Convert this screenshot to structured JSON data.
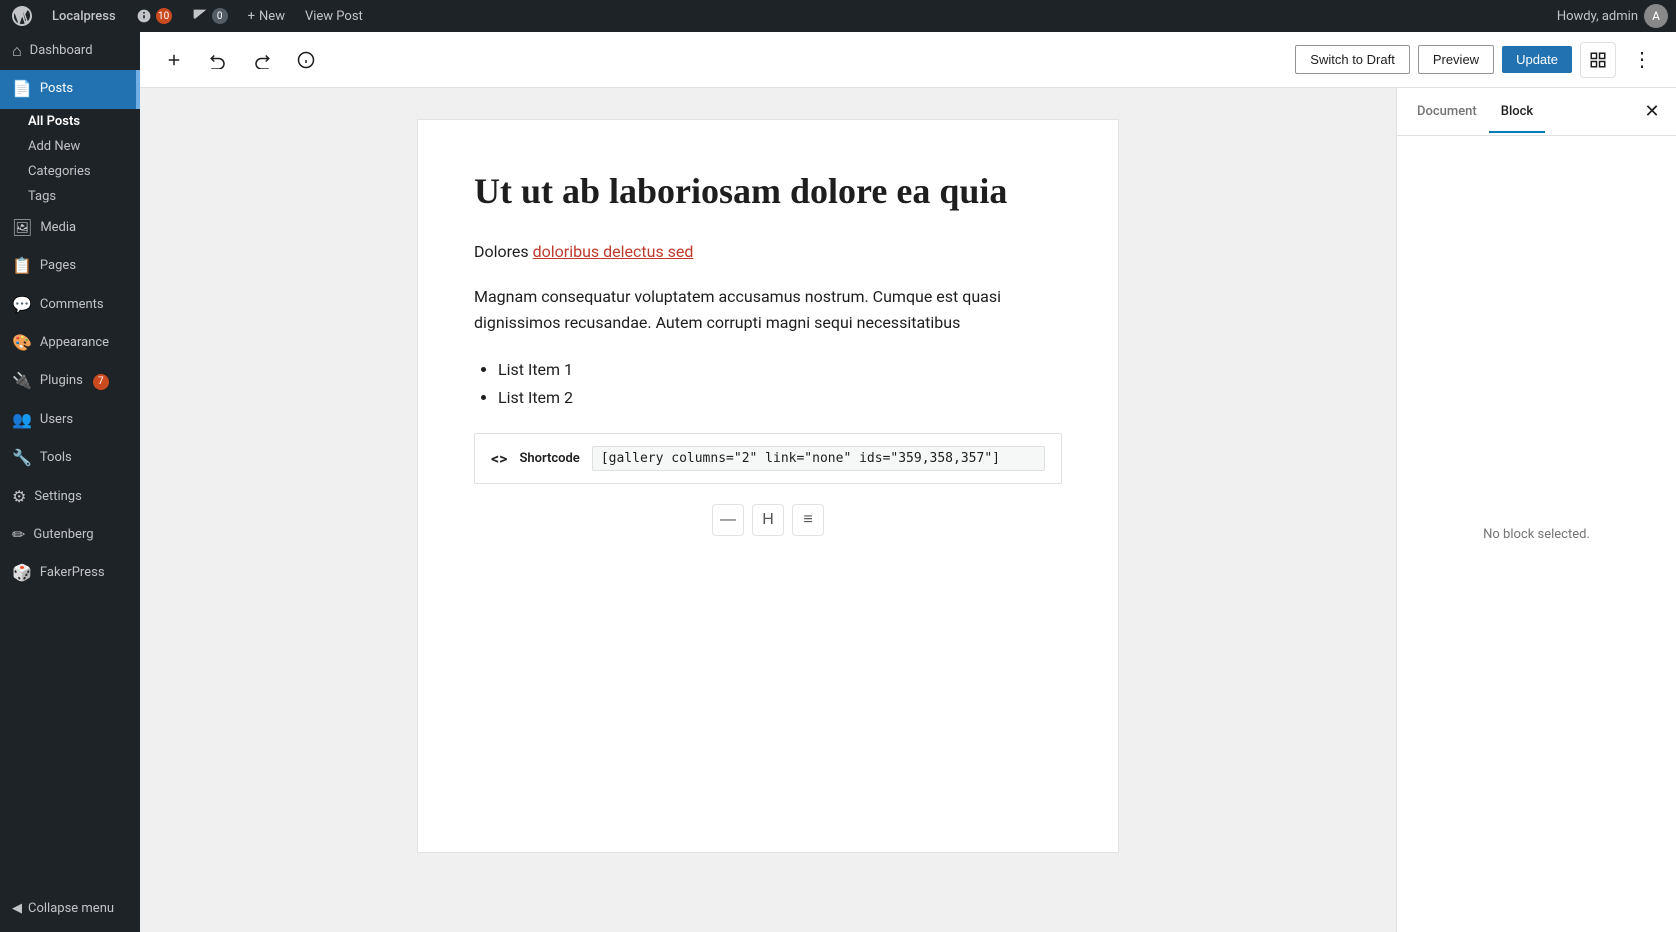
{
  "admin_bar": {
    "site_name": "Localpress",
    "updates_count": "10",
    "comments_count": "0",
    "new_label": "New",
    "view_post_label": "View Post",
    "user_label": "Howdy, admin"
  },
  "sidebar": {
    "dashboard_label": "Dashboard",
    "posts_label": "Posts",
    "posts_submenu": {
      "all_posts": "All Posts",
      "add_new": "Add New",
      "categories": "Categories",
      "tags": "Tags"
    },
    "media_label": "Media",
    "pages_label": "Pages",
    "comments_label": "Comments",
    "appearance_label": "Appearance",
    "plugins_label": "Plugins",
    "plugins_badge": "7",
    "users_label": "Users",
    "tools_label": "Tools",
    "settings_label": "Settings",
    "gutenberg_label": "Gutenberg",
    "fakerpress_label": "FakerPress",
    "collapse_label": "Collapse menu"
  },
  "toolbar": {
    "switch_to_draft_label": "Switch to Draft",
    "preview_label": "Preview",
    "update_label": "Update"
  },
  "panel": {
    "document_tab": "Document",
    "block_tab": "Block",
    "no_block_selected": "No block selected."
  },
  "editor": {
    "post_title": "Ut ut ab laboriosam dolore ea quia",
    "paragraph1_text": "Dolores ",
    "paragraph1_link": "doloribus delectus sed",
    "paragraph2_text": "Magnam consequatur voluptatem accusamus nostrum. Cumque est quasi dignissimos recusandae. Autem corrupti magni sequi necessitatibus",
    "list_items": [
      "List Item 1",
      "List Item 2"
    ],
    "shortcode_label": "Shortcode",
    "shortcode_value": "[gallery columns=\"2\" link=\"none\" ids=\"359,358,357\"]"
  }
}
